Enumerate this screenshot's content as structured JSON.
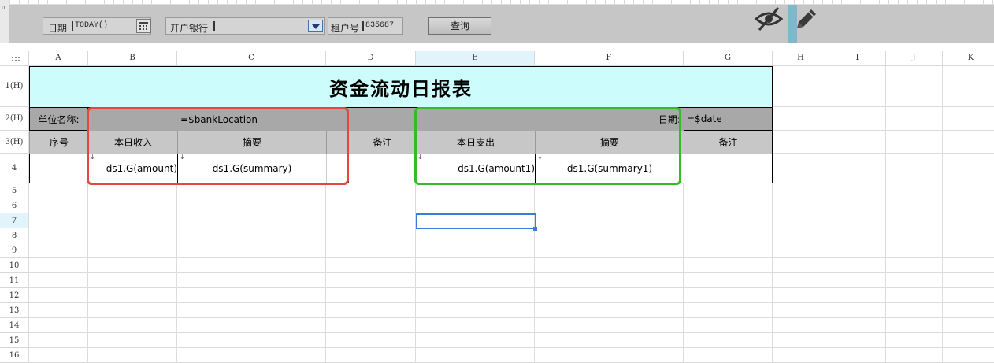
{
  "params": {
    "date_label": "日期",
    "date_value": "TODAY()",
    "bank_label": "开户银行",
    "bank_value": "",
    "account_label": "租户号",
    "account_value": "835687",
    "query_label": "查询"
  },
  "ruler": {
    "zero_label": "0"
  },
  "columns": [
    "A",
    "B",
    "C",
    "D",
    "E",
    "F",
    "G",
    "H",
    "I",
    "J",
    "K"
  ],
  "rows": [
    "1(H)",
    "2(H)",
    "3(H)",
    "4",
    "5",
    "6",
    "7",
    "8",
    "9",
    "10",
    "11",
    "12",
    "13",
    "14",
    "15",
    "16"
  ],
  "selected_column": "E",
  "selected_row": "7",
  "report": {
    "title": "资金流动日报表",
    "unit_label": "单位名称:",
    "bank_location": "=$bankLocation",
    "date_label": "日期:",
    "date_formula": "=$date",
    "headers": [
      "序号",
      "本日收入",
      "摘要",
      "备注",
      "本日支出",
      "摘要",
      "备注"
    ],
    "data_row": {
      "income": "ds1.G(amount)",
      "summary": "ds1.G(summary)",
      "expense": "ds1.G(amount1)",
      "summary1": "ds1.G(summary1)"
    }
  },
  "colors": {
    "title_bg": "#ccfcfc",
    "header_dark": "#a8a8a8",
    "header_light": "#c7c7c7",
    "highlight_red": "#e4473d",
    "highlight_green": "#33bc2a",
    "selection_blue": "#3b7cd9"
  },
  "icons": [
    "calendar-icon",
    "dropdown-arrow-icon",
    "hide-icon",
    "edit-pencil-icon",
    "select-all-icon"
  ]
}
